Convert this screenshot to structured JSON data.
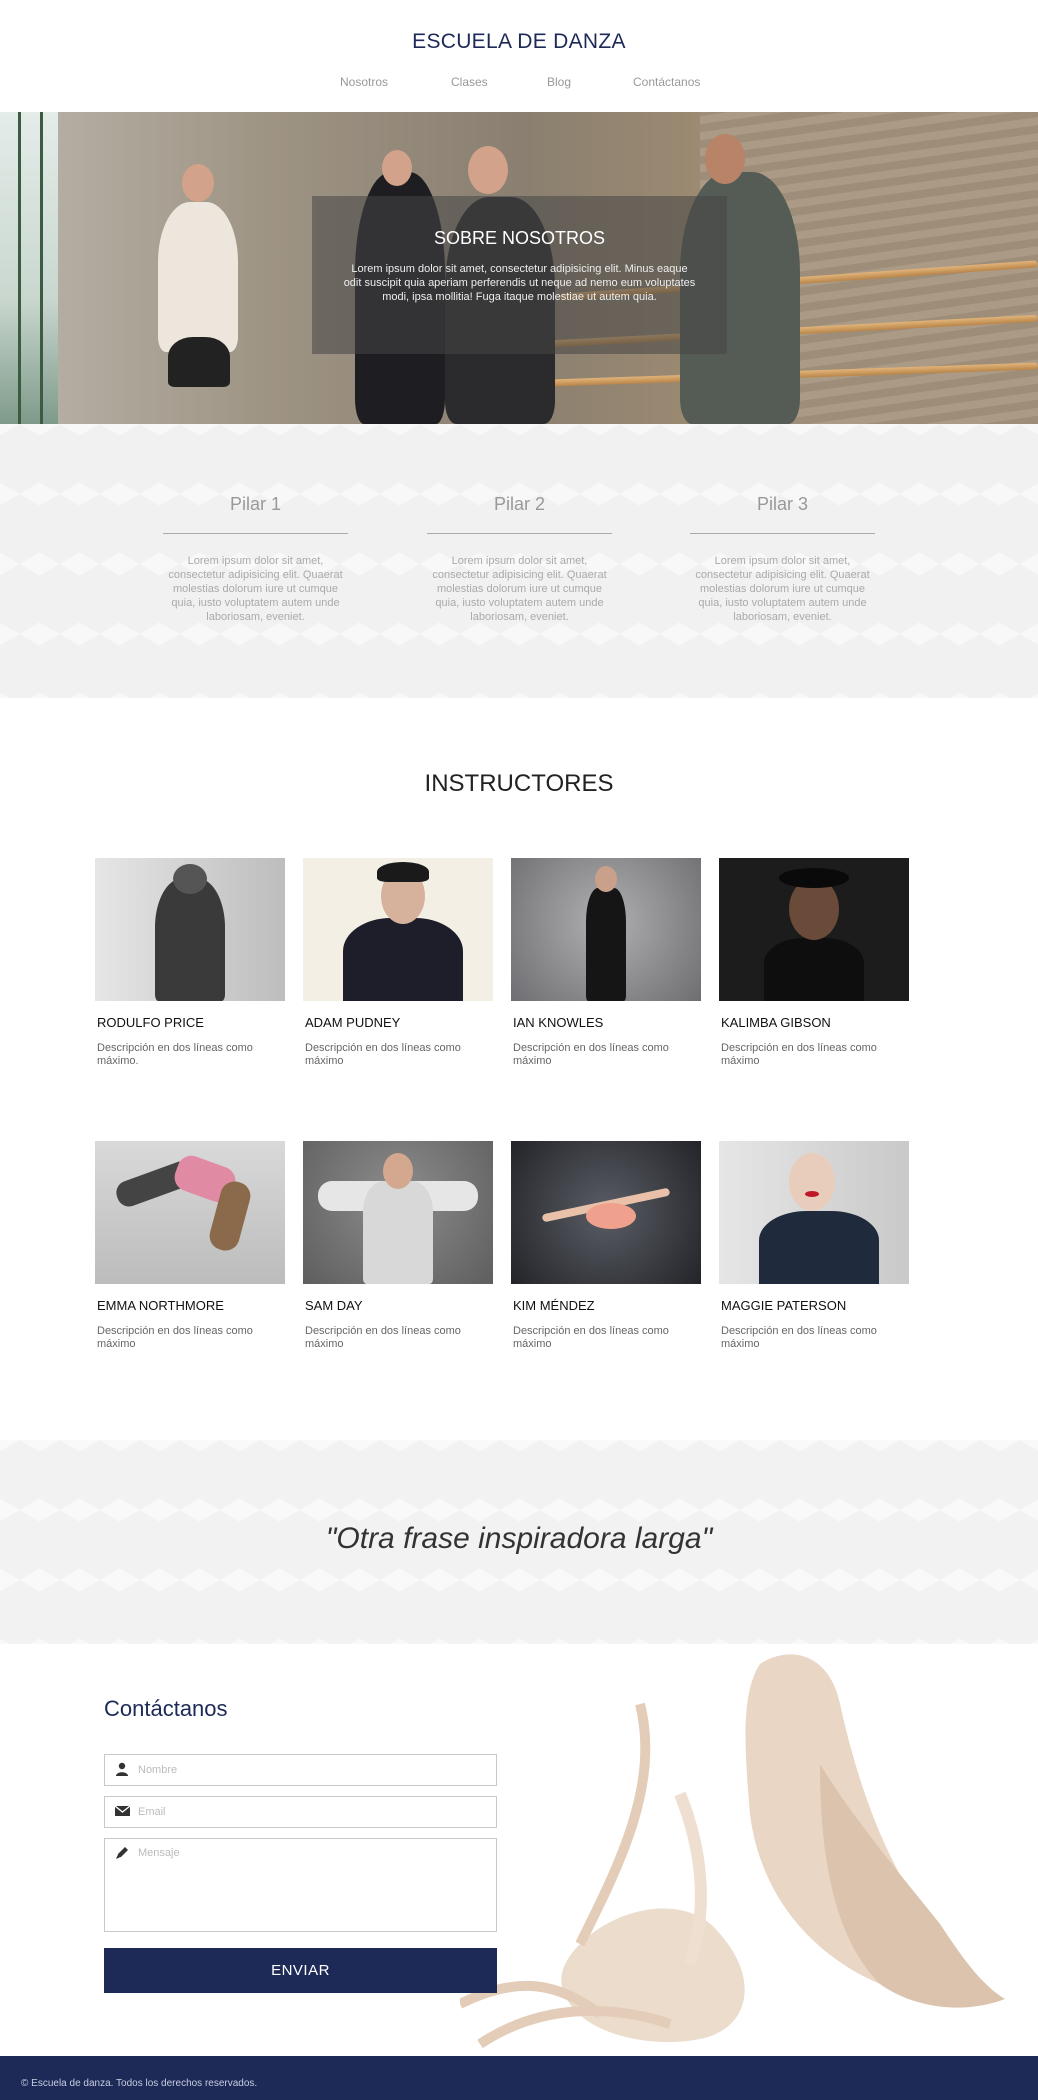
{
  "header": {
    "title": "ESCUELA DE DANZA",
    "nav": [
      "Nosotros",
      "Clases",
      "Blog",
      "Contáctanos"
    ]
  },
  "hero": {
    "title": "SOBRE NOSOTROS",
    "text": "Lorem ipsum dolor sit amet, consectetur adipisicing elit. Minus eaque odit suscipit quia aperiam perferendis ut neque ad nemo eum voluptates modi, ipsa mollitia! Fuga itaque molestiae ut autem quia."
  },
  "pillars": [
    {
      "title": "Pilar 1",
      "text": "Lorem ipsum dolor sit amet, consectetur adipisicing elit. Quaerat molestias dolorum iure ut cumque quia, iusto voluptatem autem unde laboriosam, eveniet."
    },
    {
      "title": "Pilar 2",
      "text": "Lorem ipsum dolor sit amet, consectetur adipisicing elit. Quaerat molestias dolorum iure ut cumque quia, iusto voluptatem autem unde laboriosam, eveniet."
    },
    {
      "title": "Pilar 3",
      "text": "Lorem ipsum dolor sit amet, consectetur adipisicing elit. Quaerat molestias dolorum iure ut cumque quia, iusto voluptatem autem unde laboriosam, eveniet."
    }
  ],
  "instructors": {
    "title": "INSTRUCTORES",
    "items": [
      {
        "name": "RODULFO PRICE",
        "desc": "Descripción en dos líneas como máximo."
      },
      {
        "name": "ADAM PUDNEY",
        "desc": "Descripción en dos líneas como máximo"
      },
      {
        "name": "IAN KNOWLES",
        "desc": "Descripción en dos líneas como máximo"
      },
      {
        "name": "KALIMBA GIBSON",
        "desc": "Descripción en dos líneas como máximo"
      },
      {
        "name": "EMMA NORTHMORE",
        "desc": "Descripción en dos líneas como máximo"
      },
      {
        "name": "SAM DAY",
        "desc": "Descripción en dos líneas como máximo"
      },
      {
        "name": "KIM MÉNDEZ",
        "desc": "Descripción en dos líneas como máximo"
      },
      {
        "name": "MAGGIE PATERSON",
        "desc": "Descripción en dos líneas como máximo"
      }
    ]
  },
  "quote": "\"Otra frase inspiradora larga\"",
  "contact": {
    "title": "Contáctanos",
    "name_placeholder": "Nombre",
    "email_placeholder": "Email",
    "message_placeholder": "Mensaje",
    "send_label": "ENVIAR"
  },
  "footer": "© Escuela de danza. Todos los derechos reservados.",
  "colors": {
    "brand_navy": "#1d2a57"
  },
  "icons": {
    "name_field": "user-icon",
    "email_field": "envelope-icon",
    "message_field": "pencil-icon"
  }
}
